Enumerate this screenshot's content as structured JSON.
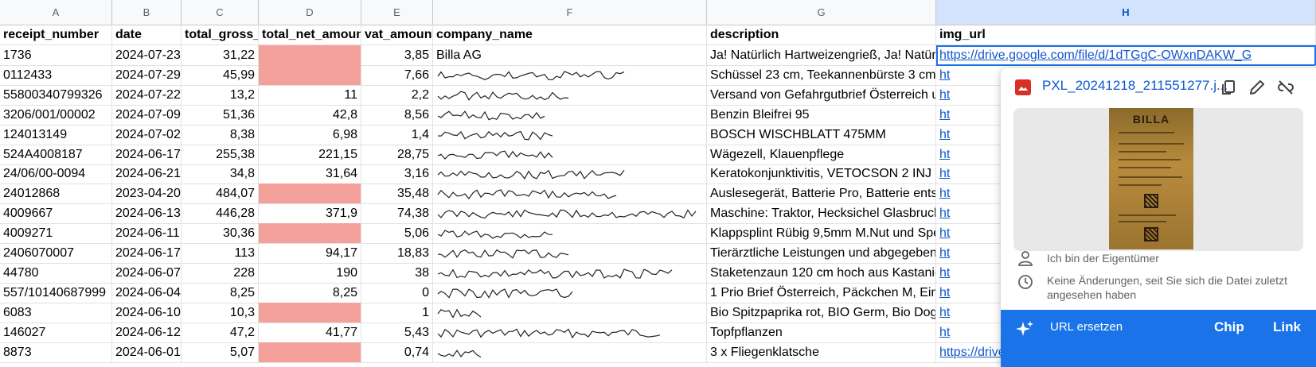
{
  "columns": [
    {
      "letter": "A"
    },
    {
      "letter": "B"
    },
    {
      "letter": "C"
    },
    {
      "letter": "D"
    },
    {
      "letter": "E"
    },
    {
      "letter": "F"
    },
    {
      "letter": "G"
    },
    {
      "letter": "H"
    }
  ],
  "headers": [
    "receipt_number",
    "date",
    "total_gross_",
    "total_net_amoun",
    "vat_amount",
    "company_name",
    "description",
    "img_url"
  ],
  "rows": [
    {
      "receipt": "1736",
      "date": "2024-07-23",
      "gross": "31,22",
      "net": "",
      "vat": "3,85",
      "company": "Billa AG",
      "desc": "Ja! Natürlich Hartweizengrieß, Ja! Natür",
      "url": "https://drive.google.com/file/d/1dTGgC-OWxnDAKW_G"
    },
    {
      "receipt": "0112433",
      "date": "2024-07-29",
      "gross": "45,99",
      "net": "",
      "vat": "7,66",
      "company": "",
      "desc": "Schüssel 23 cm, Teekannenbürste 3 cm,",
      "url": "ht"
    },
    {
      "receipt": "55800340799326",
      "date": "2024-07-22",
      "gross": "13,2",
      "net": "11",
      "vat": "2,2",
      "company": "",
      "desc": "Versand von Gefahrgutbrief Österreich u",
      "url": "ht"
    },
    {
      "receipt": "3206/001/00002",
      "date": "2024-07-09",
      "gross": "51,36",
      "net": "42,8",
      "vat": "8,56",
      "company": "",
      "desc": "Benzin Bleifrei 95",
      "url": "ht"
    },
    {
      "receipt": "124013149",
      "date": "2024-07-02",
      "gross": "8,38",
      "net": "6,98",
      "vat": "1,4",
      "company": "",
      "desc": "BOSCH WISCHBLATT 475MM",
      "url": "ht"
    },
    {
      "receipt": "524A4008187",
      "date": "2024-06-17",
      "gross": "255,38",
      "net": "221,15",
      "vat": "28,75",
      "company": "",
      "desc": "Wägezell, Klauenpflege",
      "url": "ht"
    },
    {
      "receipt": "24/06/00-0094",
      "date": "2024-06-21",
      "gross": "34,8",
      "net": "31,64",
      "vat": "3,16",
      "company": "",
      "desc": "Keratokonjunktivitis, VETOCSON 2 INJ",
      "url": "ht"
    },
    {
      "receipt": "24012868",
      "date": "2023-04-20",
      "gross": "484,07",
      "net": "",
      "vat": "35,48",
      "company": "",
      "desc": "Auslesegerät, Batterie Pro, Batterie ents",
      "url": "ht"
    },
    {
      "receipt": "4009667",
      "date": "2024-06-13",
      "gross": "446,28",
      "net": "371,9",
      "vat": "74,38",
      "company": "",
      "desc": "Maschine: Traktor, Hecksichel Glasbruch",
      "url": "ht"
    },
    {
      "receipt": "4009271",
      "date": "2024-06-11",
      "gross": "30,36",
      "net": "",
      "vat": "5,06",
      "company": "",
      "desc": "Klappsplint Rübig 9,5mm M.Nut und Spe",
      "url": "ht"
    },
    {
      "receipt": "2406070007",
      "date": "2024-06-17",
      "gross": "113",
      "net": "94,17",
      "vat": "18,83",
      "company": "",
      "desc": "Tierärztliche Leistungen und abgegebene",
      "url": "ht"
    },
    {
      "receipt": "44780",
      "date": "2024-06-07",
      "gross": "228",
      "net": "190",
      "vat": "38",
      "company": "",
      "desc": "Staketenzaun 120 cm hoch aus Kastanie",
      "url": "ht"
    },
    {
      "receipt": "557/10140687999",
      "date": "2024-06-04",
      "gross": "8,25",
      "net": "8,25",
      "vat": "0",
      "company": "",
      "desc": "1 Prio Brief Österreich, Päckchen M, Ein",
      "url": "ht"
    },
    {
      "receipt": "6083",
      "date": "2024-06-10",
      "gross": "10,3",
      "net": "",
      "vat": "1",
      "company": "",
      "desc": "Bio Spitzpaprika rot, BIO Germ, Bio Dog",
      "url": "ht"
    },
    {
      "receipt": "146027",
      "date": "2024-06-12",
      "gross": "47,2",
      "net": "41,77",
      "vat": "5,43",
      "company": "",
      "desc": "Topfpflanzen",
      "url": "ht"
    },
    {
      "receipt": "8873",
      "date": "2024-06-01",
      "gross": "5,07",
      "net": "",
      "vat": "0,74",
      "company": "",
      "desc": "3 x Fliegenklatsche",
      "url": "https://drive.google.com/file/d/"
    }
  ],
  "chip": {
    "file_name": "PXL_20241218_211551277.j...",
    "receipt_title": "BILLA",
    "owner_text": "Ich bin der Eigentümer",
    "changes_text": "Keine Änderungen, seit Sie sich die Datei zuletzt angesehen haben",
    "replace_label": "URL ersetzen",
    "chip_button": "Chip",
    "link_button": "Link"
  },
  "colors": {
    "accent": "#1a73e8",
    "link": "#1155cc",
    "empty_cell": "#f4a09b",
    "selected_header": "#d3e3fd"
  }
}
